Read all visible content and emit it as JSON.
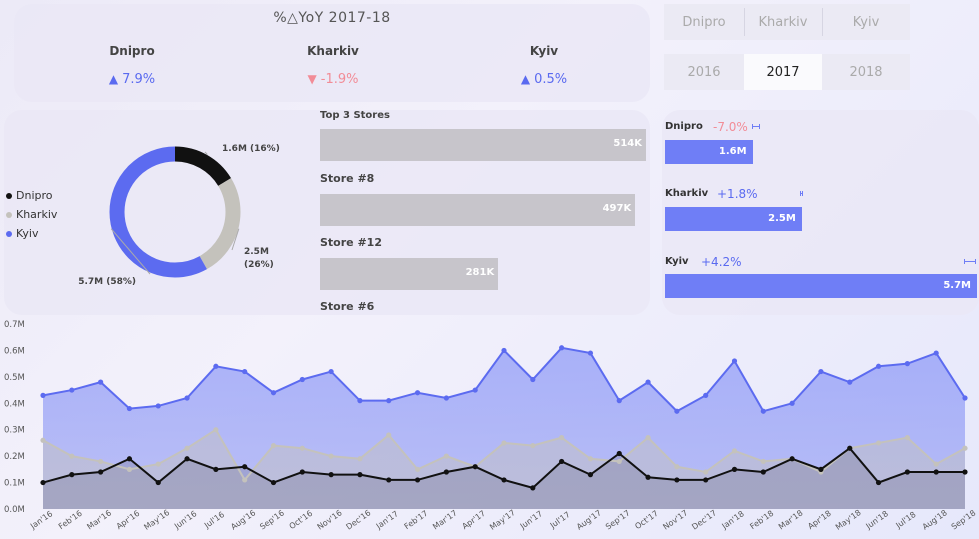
{
  "yoy": {
    "title": "%△YoY 2017-18",
    "cities": [
      {
        "name": "Dnipro",
        "value": "7.9%",
        "direction": "up",
        "arrow": "▲"
      },
      {
        "name": "Kharkiv",
        "value": "-1.9%",
        "direction": "down",
        "arrow": "▼"
      },
      {
        "name": "Kyiv",
        "value": "0.5%",
        "direction": "up",
        "arrow": "▲"
      }
    ]
  },
  "city_slicer": {
    "options": [
      "Dnipro",
      "Kharkiv",
      "Kyiv"
    ]
  },
  "year_slicer": {
    "options": [
      "2016",
      "2017",
      "2018"
    ],
    "selected": "2017"
  },
  "colors": {
    "dnipro": "#111111",
    "kharkiv": "#c4c2bc",
    "kyiv": "#5c6bf0",
    "up": "#5a6af0",
    "down": "#f28c97"
  },
  "top_stores": {
    "title": "Top 3 Stores",
    "stores": [
      {
        "value_label": "514K",
        "name": "Store #8",
        "value": 514
      },
      {
        "value_label": "497K",
        "name": "Store #12",
        "value": 497
      },
      {
        "value_label": "281K",
        "name": "Store #6",
        "value": 281
      }
    ]
  },
  "city_bars": [
    {
      "name": "Dnipro",
      "pct": "-7.0%",
      "direction": "down",
      "value_label": "1.6M",
      "value": 1.6
    },
    {
      "name": "Kharkiv",
      "pct": "+1.8%",
      "direction": "up",
      "value_label": "2.5M",
      "value": 2.5
    },
    {
      "name": "Kyiv",
      "pct": "+4.2%",
      "direction": "up",
      "value_label": "5.7M",
      "value": 5.7
    }
  ],
  "chart_data": [
    {
      "type": "pie",
      "legend": [
        "Dnipro",
        "Kharkiv",
        "Kyiv"
      ],
      "legend_position": "left",
      "slices": [
        {
          "name": "Dnipro",
          "value": 1.6,
          "label": "1.6M (16%)"
        },
        {
          "name": "Kharkiv",
          "value": 2.5,
          "label": "2.5M (26%)"
        },
        {
          "name": "Kyiv",
          "value": 5.7,
          "label": "5.7M (58%)"
        }
      ]
    },
    {
      "type": "area",
      "x": [
        "Jan'16",
        "Feb'16",
        "Mar'16",
        "Apr'16",
        "May'16",
        "Jun'16",
        "Jul'16",
        "Aug'16",
        "Sep'16",
        "Oct'16",
        "Nov'16",
        "Dec'16",
        "Jan'17",
        "Feb'17",
        "Mar'17",
        "Apr'17",
        "May'17",
        "Jun'17",
        "Jul'17",
        "Aug'17",
        "Sep'17",
        "Oct'17",
        "Nov'17",
        "Dec'17",
        "Jan'18",
        "Feb'18",
        "Mar'18",
        "Apr'18",
        "May'18",
        "Jun'18",
        "Jul'18",
        "Aug'18",
        "Sep'18"
      ],
      "y_ticks": [
        "0.0M",
        "0.1M",
        "0.2M",
        "0.3M",
        "0.4M",
        "0.5M",
        "0.6M",
        "0.7M"
      ],
      "ylim": [
        0,
        0.7
      ],
      "grid": false,
      "series": [
        {
          "name": "Kyiv",
          "values": [
            0.43,
            0.45,
            0.48,
            0.38,
            0.39,
            0.42,
            0.54,
            0.52,
            0.44,
            0.49,
            0.52,
            0.41,
            0.41,
            0.44,
            0.42,
            0.45,
            0.6,
            0.49,
            0.61,
            0.59,
            0.41,
            0.48,
            0.37,
            0.43,
            0.56,
            0.37,
            0.4,
            0.52,
            0.48,
            0.54,
            0.55,
            0.59,
            0.42
          ]
        },
        {
          "name": "Kharkiv",
          "values": [
            0.26,
            0.2,
            0.18,
            0.15,
            0.17,
            0.23,
            0.3,
            0.11,
            0.24,
            0.23,
            0.2,
            0.19,
            0.28,
            0.15,
            0.2,
            0.16,
            0.25,
            0.24,
            0.27,
            0.19,
            0.18,
            0.27,
            0.16,
            0.14,
            0.22,
            0.18,
            0.19,
            0.14,
            0.23,
            0.25,
            0.27,
            0.17,
            0.23
          ]
        },
        {
          "name": "Dnipro",
          "values": [
            0.1,
            0.13,
            0.14,
            0.19,
            0.1,
            0.19,
            0.15,
            0.16,
            0.1,
            0.14,
            0.13,
            0.13,
            0.11,
            0.11,
            0.14,
            0.16,
            0.11,
            0.08,
            0.18,
            0.13,
            0.21,
            0.12,
            0.11,
            0.11,
            0.15,
            0.14,
            0.19,
            0.15,
            0.23,
            0.1,
            0.14,
            0.14,
            0.14
          ]
        }
      ]
    }
  ]
}
